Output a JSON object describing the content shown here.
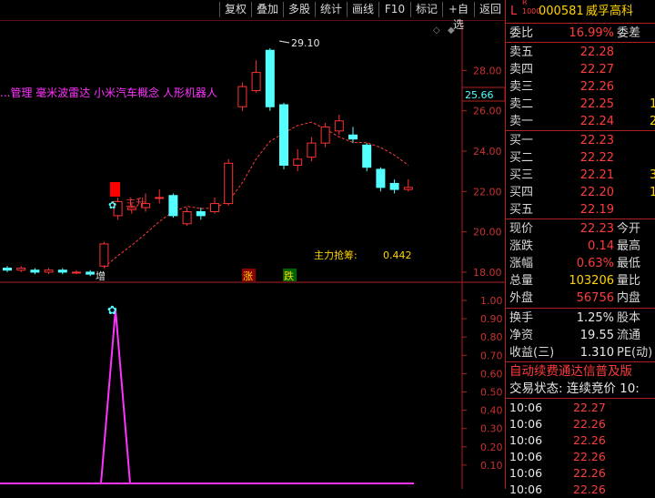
{
  "toolbar": {
    "buttons": [
      "复权",
      "叠加",
      "多股",
      "统计",
      "画线",
      "F10",
      "标记",
      "+自选",
      "返回"
    ]
  },
  "chart": {
    "concept_tags": "...管理 毫米波雷达 小米汽车概念 人形机器人",
    "max_label": "29.10",
    "current_price_tag": "25.66",
    "main_lift_label": "主升",
    "main_force_label": "主力抢筹:",
    "main_force_value": "0.442",
    "markers": [
      "增",
      "涨",
      "跌"
    ],
    "y_ticks_main": [
      "28.00",
      "26.00",
      "24.00",
      "22.00",
      "20.00",
      "18.00"
    ],
    "y_ticks_sub": [
      "1.00",
      "0.90",
      "0.80",
      "0.70",
      "0.60",
      "0.50",
      "0.40",
      "0.30",
      "0.20",
      "0.10"
    ]
  },
  "chart_data": {
    "type": "candlestick",
    "ylim": [
      17.5,
      30.5
    ],
    "candles": [
      {
        "o": 18.2,
        "c": 18.1,
        "h": 18.3,
        "l": 18.0
      },
      {
        "o": 18.1,
        "c": 18.2,
        "h": 18.3,
        "l": 18.0
      },
      {
        "o": 18.1,
        "c": 18.0,
        "h": 18.2,
        "l": 17.9
      },
      {
        "o": 18.0,
        "c": 18.1,
        "h": 18.2,
        "l": 17.9
      },
      {
        "o": 18.1,
        "c": 18.0,
        "h": 18.2,
        "l": 17.9
      },
      {
        "o": 18.0,
        "c": 18.0,
        "h": 18.1,
        "l": 17.9
      },
      {
        "o": 18.0,
        "c": 17.9,
        "h": 18.1,
        "l": 17.8
      },
      {
        "o": 18.3,
        "c": 19.4,
        "h": 19.5,
        "l": 18.2
      },
      {
        "o": 20.8,
        "c": 21.5,
        "h": 21.7,
        "l": 20.6
      },
      {
        "o": 21.1,
        "c": 21.2,
        "h": 21.4,
        "l": 20.9
      },
      {
        "o": 21.2,
        "c": 21.4,
        "h": 21.9,
        "l": 21.0
      },
      {
        "o": 21.7,
        "c": 21.7,
        "h": 22.1,
        "l": 21.4
      },
      {
        "o": 21.8,
        "c": 20.8,
        "h": 21.9,
        "l": 20.7
      },
      {
        "o": 20.4,
        "c": 21.0,
        "h": 21.2,
        "l": 20.3
      },
      {
        "o": 21.0,
        "c": 20.8,
        "h": 21.2,
        "l": 20.6
      },
      {
        "o": 21.0,
        "c": 21.4,
        "h": 21.7,
        "l": 20.9
      },
      {
        "o": 21.4,
        "c": 23.4,
        "h": 23.6,
        "l": 21.3
      },
      {
        "o": 26.2,
        "c": 27.2,
        "h": 27.4,
        "l": 26.0
      },
      {
        "o": 27.0,
        "c": 27.9,
        "h": 28.5,
        "l": 26.9
      },
      {
        "o": 29.0,
        "c": 26.2,
        "h": 29.1,
        "l": 26.0
      },
      {
        "o": 26.3,
        "c": 23.3,
        "h": 26.4,
        "l": 23.1
      },
      {
        "o": 23.3,
        "c": 23.6,
        "h": 24.1,
        "l": 23.0
      },
      {
        "o": 23.7,
        "c": 24.4,
        "h": 24.7,
        "l": 23.5
      },
      {
        "o": 24.4,
        "c": 25.2,
        "h": 25.4,
        "l": 24.2
      },
      {
        "o": 25.0,
        "c": 25.5,
        "h": 25.8,
        "l": 24.8
      },
      {
        "o": 24.8,
        "c": 24.6,
        "h": 25.2,
        "l": 24.4
      },
      {
        "o": 24.3,
        "c": 23.2,
        "h": 24.4,
        "l": 23.0
      },
      {
        "o": 23.1,
        "c": 22.2,
        "h": 23.2,
        "l": 22.0
      },
      {
        "o": 22.4,
        "c": 22.1,
        "h": 22.6,
        "l": 21.9
      },
      {
        "o": 22.1,
        "c": 22.2,
        "h": 22.6,
        "l": 22.0
      }
    ],
    "sub_ylim": [
      0,
      1.05
    ]
  },
  "quote": {
    "stock_code": "000581",
    "stock_name": "威孚高科",
    "webi_label": "委比",
    "webi_value": "16.99%",
    "weicha_label": "委差",
    "asks": [
      {
        "label": "卖五",
        "price": "22.28"
      },
      {
        "label": "卖四",
        "price": "22.27"
      },
      {
        "label": "卖三",
        "price": "22.26"
      },
      {
        "label": "卖二",
        "price": "22.25",
        "vol": "1"
      },
      {
        "label": "卖一",
        "price": "22.24",
        "vol": "2"
      }
    ],
    "bids": [
      {
        "label": "买一",
        "price": "22.23"
      },
      {
        "label": "买二",
        "price": "22.22"
      },
      {
        "label": "买三",
        "price": "22.21",
        "vol": "3"
      },
      {
        "label": "买四",
        "price": "22.20",
        "vol": "1"
      },
      {
        "label": "买五",
        "price": "22.19"
      }
    ],
    "stats": [
      {
        "label": "现价",
        "value": "22.23",
        "rlabel": "今开",
        "color": "red"
      },
      {
        "label": "涨跌",
        "value": "0.14",
        "rlabel": "最高",
        "color": "red"
      },
      {
        "label": "涨幅",
        "value": "0.63%",
        "rlabel": "最低",
        "color": "red"
      },
      {
        "label": "总量",
        "value": "103206",
        "rlabel": "量比",
        "color": "yellow"
      },
      {
        "label": "外盘",
        "value": "56756",
        "rlabel": "内盘",
        "color": "red"
      }
    ],
    "stats2": [
      {
        "label": "换手",
        "value": "1.25%",
        "rlabel": "股本"
      },
      {
        "label": "净资",
        "value": "19.55",
        "rlabel": "流通"
      },
      {
        "label": "收益(三)",
        "value": "1.310",
        "rlabel": "PE(动)"
      }
    ],
    "promo": "自动续费通达信普及版",
    "trade_status": "交易状态: 连续竞价 10:",
    "ticks": [
      {
        "time": "10:06",
        "price": "22.27"
      },
      {
        "time": "10:06",
        "price": "22.26"
      },
      {
        "time": "10:06",
        "price": "22.26"
      },
      {
        "time": "10:06",
        "price": "22.26"
      },
      {
        "time": "10:06",
        "price": "22.26"
      },
      {
        "time": "10:06",
        "price": "22.26"
      }
    ]
  },
  "colors": {
    "up": "#ff3232",
    "down": "#54ffff",
    "frame": "#b02020",
    "ma": "#ff3c3c",
    "signal": "#ff32ff"
  }
}
